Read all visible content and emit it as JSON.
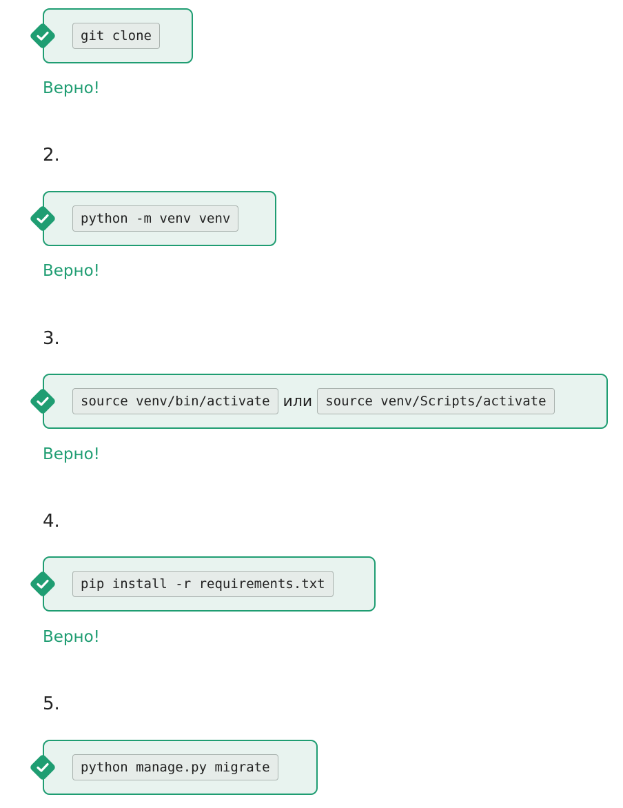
{
  "steps": [
    {
      "number": "",
      "commands": [
        "git clone"
      ],
      "connector": "",
      "feedback": "Верно!"
    },
    {
      "number": "2.",
      "commands": [
        "python -m venv venv"
      ],
      "connector": "",
      "feedback": "Верно!"
    },
    {
      "number": "3.",
      "commands": [
        "source venv/bin/activate",
        "source venv/Scripts/activate"
      ],
      "connector": "или",
      "feedback": "Верно!"
    },
    {
      "number": "4.",
      "commands": [
        "pip install -r requirements.txt"
      ],
      "connector": "",
      "feedback": "Верно!"
    },
    {
      "number": "5.",
      "commands": [
        "python manage.py migrate"
      ],
      "connector": "",
      "feedback": ""
    }
  ],
  "icons": {
    "check": "checkmark-diamond-icon"
  },
  "colors": {
    "accent": "#1f9d72",
    "box_background": "#e8f3ef",
    "chip_background": "#e6ece9",
    "chip_border": "#a9b2ae",
    "text": "#222222"
  }
}
